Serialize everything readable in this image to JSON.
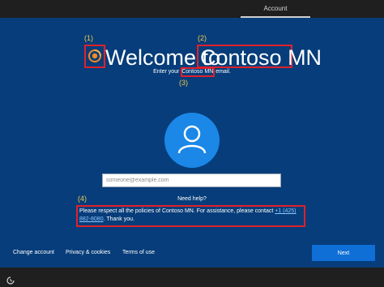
{
  "topbar": {
    "tab_label": "Account"
  },
  "annotations": {
    "a1": "(1)",
    "a2": "(2)",
    "a3": "(3)",
    "a4": "(4)"
  },
  "header": {
    "welcome_text": "Welcome to",
    "brand_name": "Contoso MN"
  },
  "signin": {
    "prompt_prefix": "Enter your",
    "prompt_org": "Contoso MN",
    "prompt_suffix": "email.",
    "email_placeholder": "someone@example.com"
  },
  "help": {
    "title": "Need help?",
    "policy_text": "Please respect all the policies of Contoso MN. For assistance, please contact",
    "phone": "+1 (425) 882-8080",
    "thanks": ". Thank you."
  },
  "footer": {
    "change_account": "Change account",
    "privacy": "Privacy & cookies",
    "terms": "Terms of use",
    "next": "Next"
  },
  "colors": {
    "background": "#063d7a",
    "accent": "#1b87e6",
    "annotation": "#f2c94c",
    "highlight": "#e0212b"
  },
  "icons": [
    "org-logo-icon",
    "user-avatar-icon",
    "ease-of-access-icon"
  ]
}
